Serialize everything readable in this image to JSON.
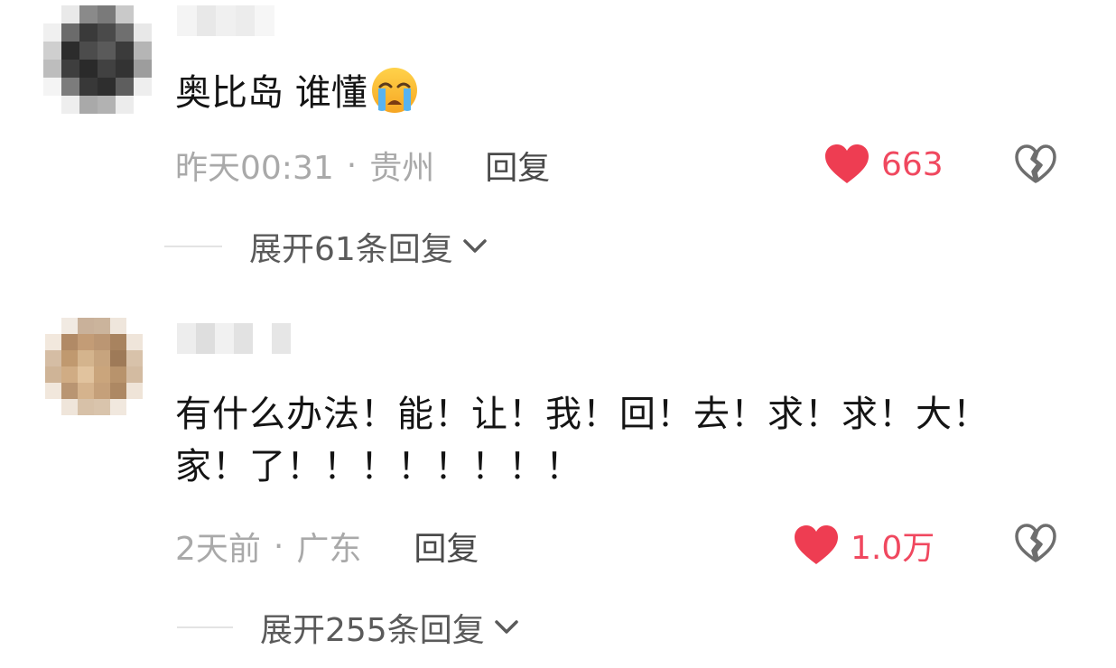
{
  "comments": [
    {
      "text": "奥比岛 谁懂",
      "emoji": "loudly-crying-face",
      "time": "昨天00:31",
      "separator": "·",
      "location": "贵州",
      "reply_label": "回复",
      "likes": "663",
      "expand_label": "展开61条回复"
    },
    {
      "text": "有什么办法！能！让！我！回！去！求！求！大！\n家！了！！！！！！！！",
      "time": "2天前",
      "separator": "·",
      "location": "广东",
      "reply_label": "回复",
      "likes": "1.0万",
      "expand_label": "展开255条回复"
    }
  ],
  "colors": {
    "like_red": "#f0485f",
    "meta_gray": "#a9a9a9",
    "reply_dark": "#4a4a4a",
    "expand_gray": "#5a5a5a"
  }
}
